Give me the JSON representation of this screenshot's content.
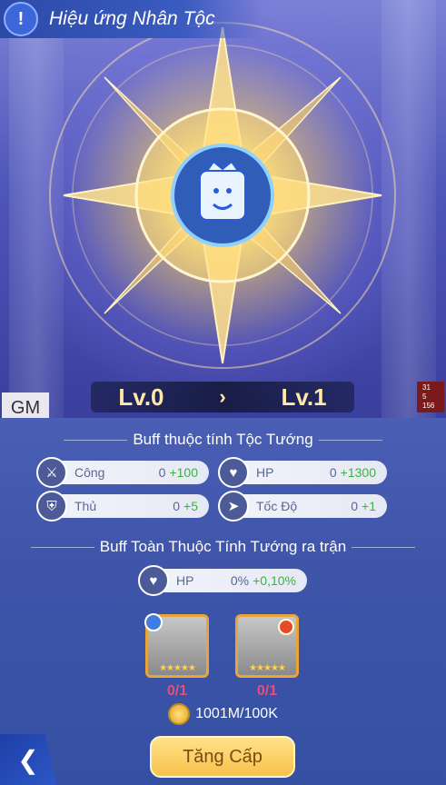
{
  "header": {
    "title": "Hiệu ứng Nhân Tộc",
    "icon": "exclamation-icon"
  },
  "gm_label": "GM",
  "level": {
    "current": "Lv.0",
    "next": "Lv.1",
    "arrow": "›"
  },
  "debug_counters": [
    "31",
    "5",
    "156"
  ],
  "section1": {
    "title": "Buff thuộc tính Tộc Tướng",
    "stats": [
      {
        "icon": "sword-icon",
        "label": "Công",
        "base": "0",
        "add": "+100"
      },
      {
        "icon": "heart-icon",
        "label": "HP",
        "base": "0",
        "add": "+1300"
      },
      {
        "icon": "shield-icon",
        "label": "Thủ",
        "base": "0",
        "add": "+5"
      },
      {
        "icon": "boot-icon",
        "label": "Tốc Độ",
        "base": "0",
        "add": "+1"
      }
    ]
  },
  "section2": {
    "title": "Buff Toàn Thuộc Tính Tướng ra trận",
    "stats": [
      {
        "icon": "heart-icon",
        "label": "HP",
        "base": "0%",
        "add": "+0,10%"
      }
    ]
  },
  "cards": [
    {
      "name": "hero-card",
      "count": "0/1",
      "stars": "★★★★★"
    },
    {
      "name": "placeholder-card",
      "count": "0/1",
      "stars": "★★★★★"
    }
  ],
  "cost": "1001M/100K",
  "upgrade_label": "Tăng Cấp",
  "colors": {
    "gold": "#f6c24a",
    "green": "#3bb33f",
    "pink": "#e64f7a"
  }
}
